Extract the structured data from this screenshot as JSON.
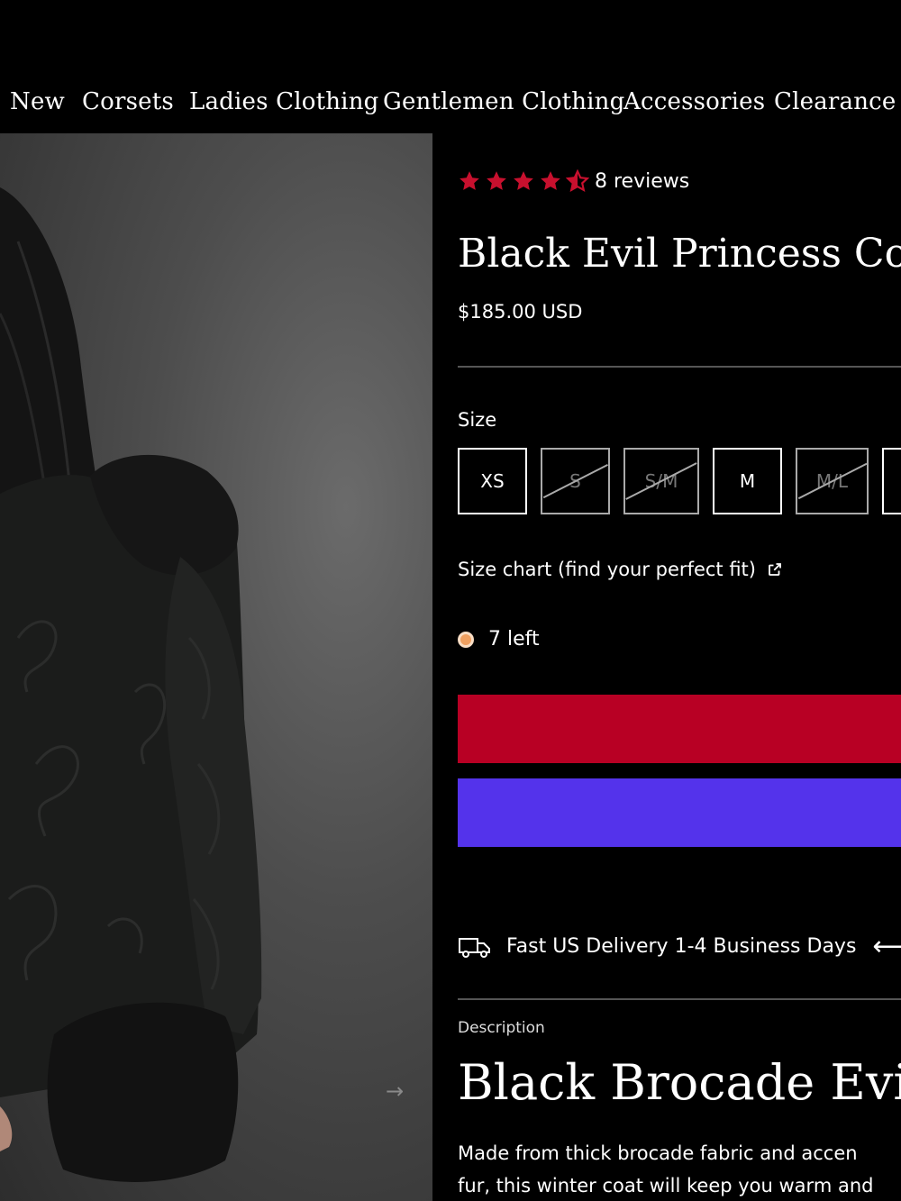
{
  "nav": {
    "items": [
      {
        "label": "New"
      },
      {
        "label": "Corsets"
      },
      {
        "label": "Ladies Clothing"
      },
      {
        "label": "Gentlemen Clothing"
      },
      {
        "label": "Accessories"
      },
      {
        "label": "Clearance"
      }
    ]
  },
  "gallery": {
    "next_icon": "arrow-right-icon"
  },
  "product": {
    "rating": 4.5,
    "rating_max": 5,
    "reviews_label": "8 reviews",
    "title": "Black Evil Princess Coat",
    "price": "$185.00 USD",
    "size_label": "Size",
    "sizes": [
      {
        "label": "XS",
        "available": true
      },
      {
        "label": "S",
        "available": false
      },
      {
        "label": "S/M",
        "available": false
      },
      {
        "label": "M",
        "available": true
      },
      {
        "label": "M/L",
        "available": false
      }
    ],
    "size_chart_label": "Size chart (find your perfect fit)",
    "stock_label": "7 left",
    "add_to_cart_color": "#b80024",
    "shop_pay_color": "#5433eb",
    "delivery_label": "Fast US Delivery 1-4 Business Days",
    "description_label": "Description",
    "description_title": "Black Brocade Evil",
    "description_lines": [
      "Made from thick brocade fabric and accen",
      "fur, this winter coat will keep you warm and"
    ]
  },
  "colors": {
    "star": "#c8102e",
    "stock_dot": "#f0a060"
  }
}
